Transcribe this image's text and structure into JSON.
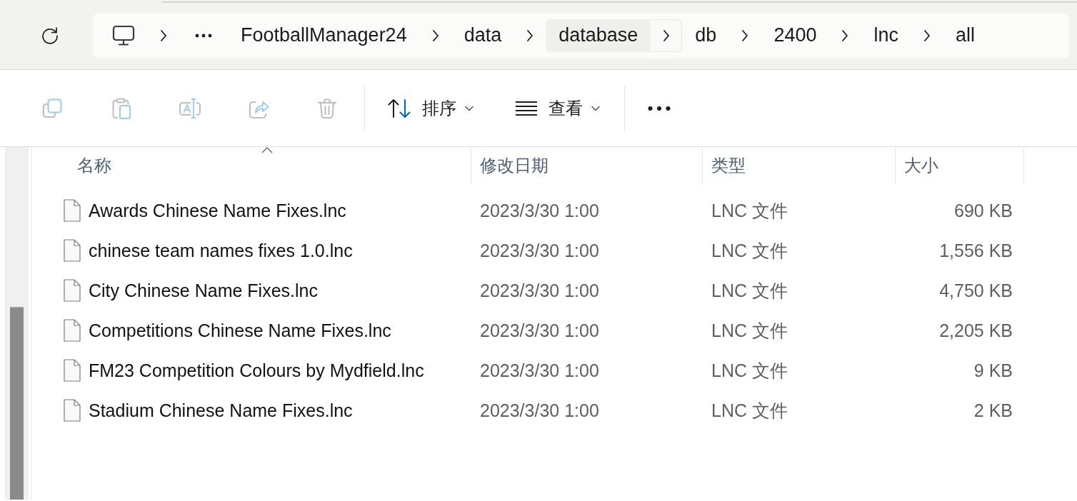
{
  "address_bar": {
    "items": [
      {
        "kind": "computer",
        "highlighted": false
      },
      {
        "kind": "overflow",
        "highlighted": false
      },
      {
        "kind": "folder",
        "label": "FootballManager24",
        "highlighted": false
      },
      {
        "kind": "folder",
        "label": "data",
        "highlighted": false
      },
      {
        "kind": "folder",
        "label": "database",
        "highlighted": true
      },
      {
        "kind": "folder",
        "label": "db",
        "highlighted": false
      },
      {
        "kind": "folder",
        "label": "2400",
        "highlighted": false
      },
      {
        "kind": "folder",
        "label": "lnc",
        "highlighted": false
      },
      {
        "kind": "folder",
        "label": "all",
        "highlighted": false
      }
    ]
  },
  "toolbar": {
    "actions": [
      {
        "kind": "copy",
        "disabled": true
      },
      {
        "kind": "paste",
        "disabled": true
      },
      {
        "kind": "rename",
        "disabled": true
      },
      {
        "kind": "share",
        "disabled": true
      },
      {
        "kind": "delete",
        "disabled": true
      }
    ],
    "menus": [
      {
        "kind": "sort",
        "label": "排序"
      },
      {
        "kind": "view",
        "label": "查看"
      }
    ]
  },
  "file_list": {
    "columns": [
      {
        "label": "名称",
        "sorted": true
      },
      {
        "label": "修改日期",
        "sorted": false
      },
      {
        "label": "类型",
        "sorted": false
      },
      {
        "label": "大小",
        "sorted": false
      }
    ],
    "rows": [
      {
        "name": "Awards Chinese Name Fixes.lnc",
        "modified": "2023/3/30 1:00",
        "type": "LNC 文件",
        "size": "690 KB"
      },
      {
        "name": "chinese team names fixes 1.0.lnc",
        "modified": "2023/3/30 1:00",
        "type": "LNC 文件",
        "size": "1,556 KB"
      },
      {
        "name": "City Chinese Name Fixes.lnc",
        "modified": "2023/3/30 1:00",
        "type": "LNC 文件",
        "size": "4,750 KB"
      },
      {
        "name": "Competitions Chinese Name Fixes.lnc",
        "modified": "2023/3/30 1:00",
        "type": "LNC 文件",
        "size": "2,205 KB"
      },
      {
        "name": "FM23 Competition Colours by Mydfield.lnc",
        "modified": "2023/3/30 1:00",
        "type": "LNC 文件",
        "size": "9 KB"
      },
      {
        "name": "Stadium Chinese Name Fixes.lnc",
        "modified": "2023/3/30 1:00",
        "type": "LNC 文件",
        "size": "2 KB"
      }
    ]
  }
}
